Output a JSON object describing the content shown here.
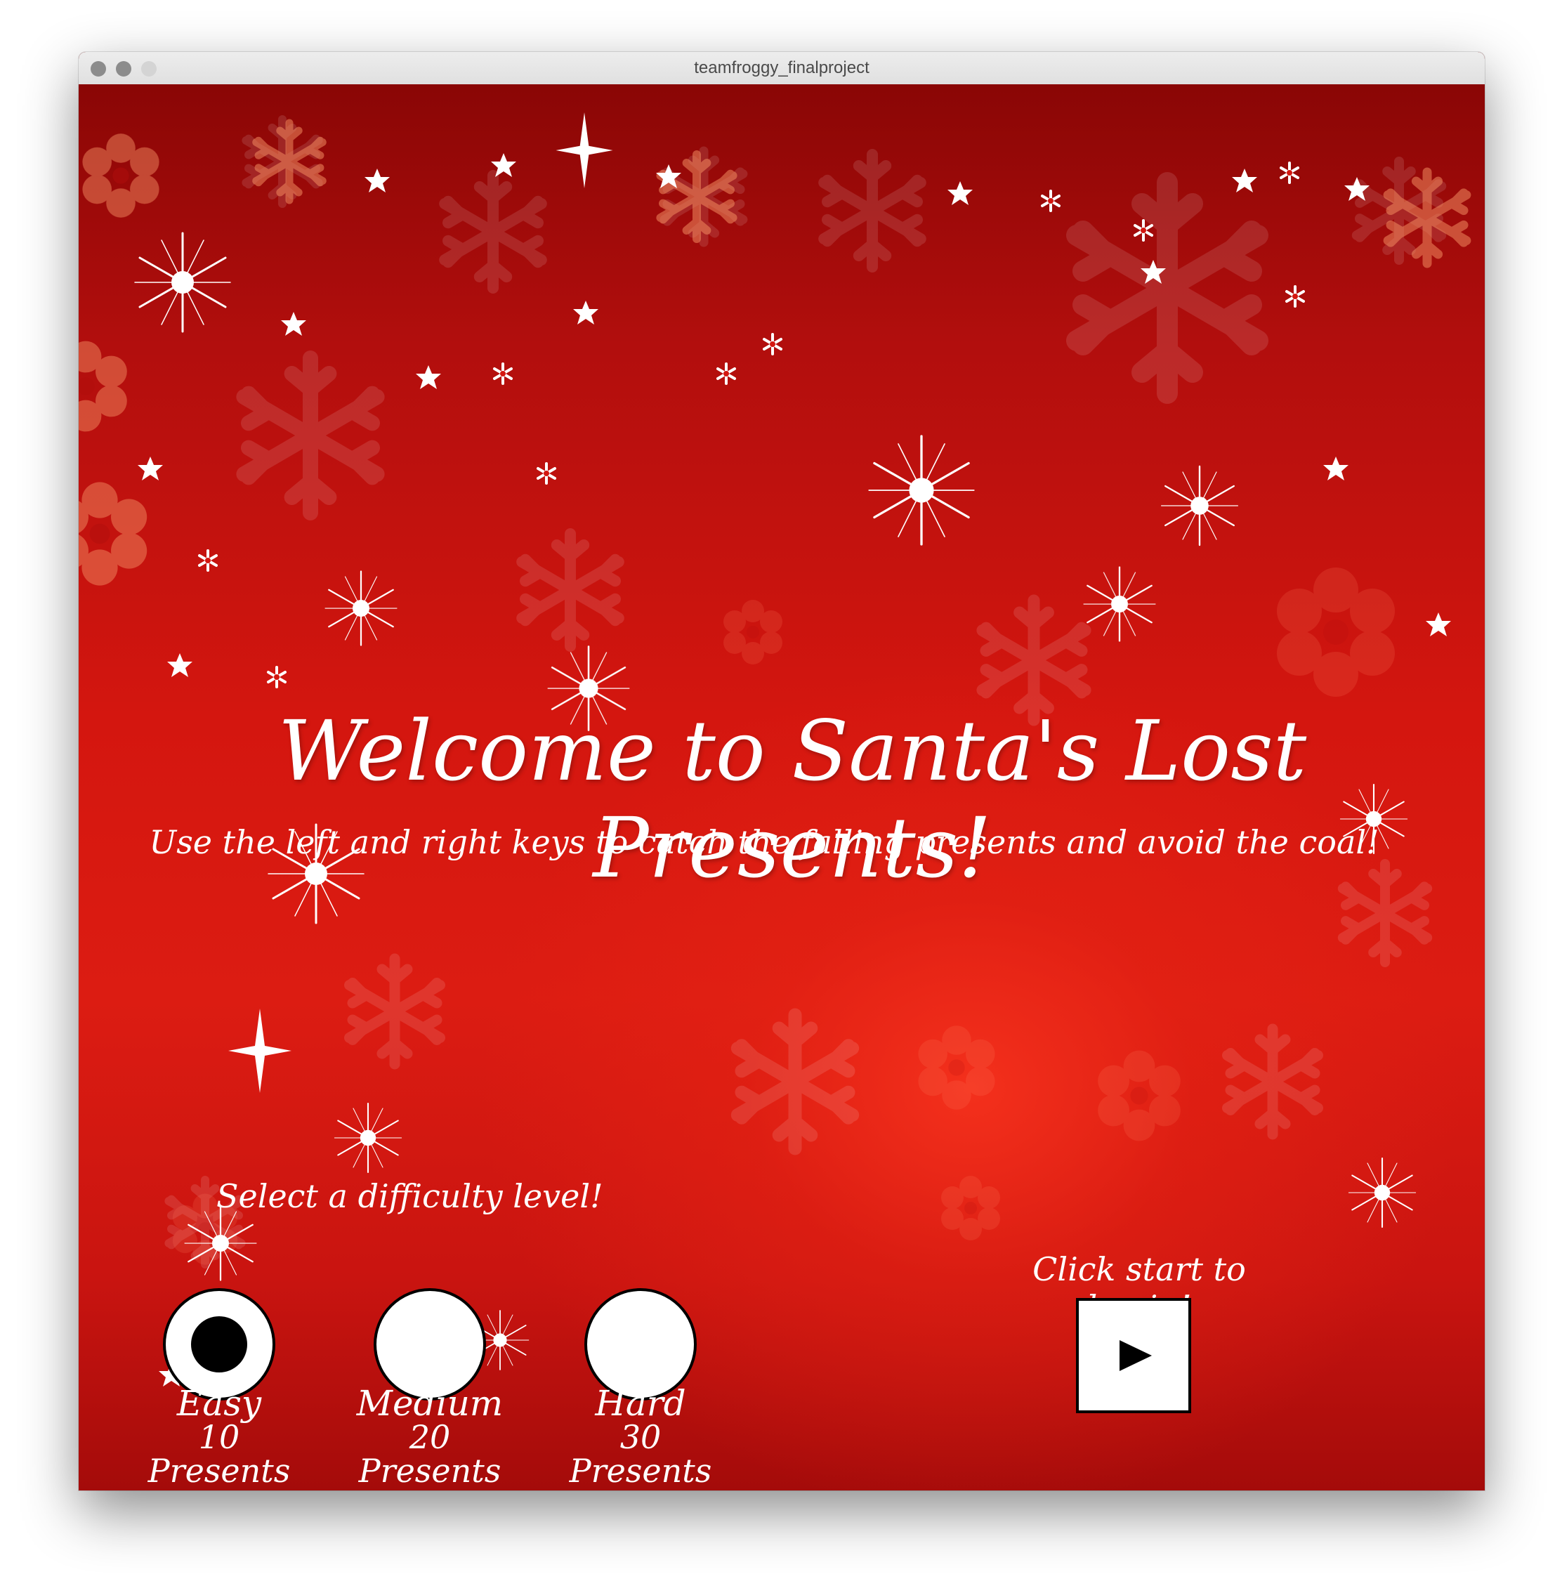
{
  "window": {
    "title": "teamfroggy_finalproject"
  },
  "game": {
    "headline": "Welcome to Santa's Lost Presents!",
    "instructions": "Use the left and right keys to catch the falling presents and avoid the coal!",
    "difficulty_prompt": "Select a difficulty level!",
    "start_prompt": "Click start to begin!",
    "levels": [
      {
        "name": "Easy",
        "presents": "10 Presents",
        "selected": true
      },
      {
        "name": "Medium",
        "presents": "20 Presents",
        "selected": false
      },
      {
        "name": "Hard",
        "presents": "30 Presents",
        "selected": false
      }
    ],
    "start_button_icon": "play-icon"
  },
  "colors": {
    "background_red": "#d4160f",
    "dark_red": "#8a0605",
    "text": "#ffffff",
    "control_fill": "#ffffff",
    "control_border": "#000000"
  }
}
